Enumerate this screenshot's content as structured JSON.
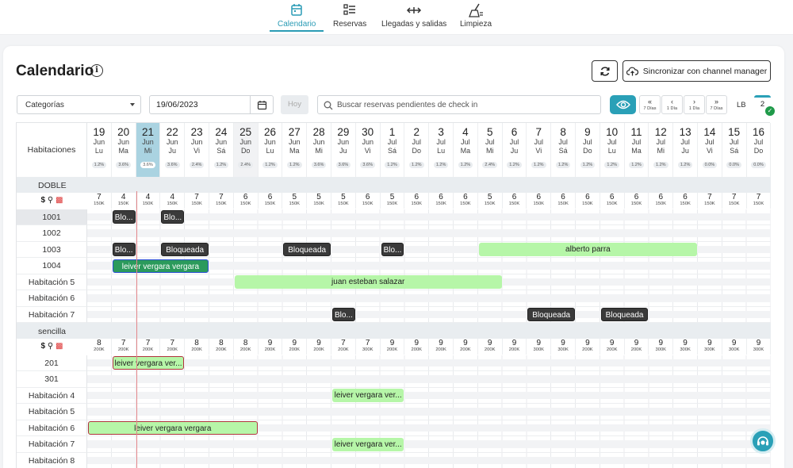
{
  "nav": [
    {
      "label": "Calendario",
      "icon": "calendar-icon",
      "active": true
    },
    {
      "label": "Reservas",
      "icon": "list-icon",
      "active": false
    },
    {
      "label": "Llegadas y salidas",
      "icon": "arrows-icon",
      "active": false
    },
    {
      "label": "Limpieza",
      "icon": "broom-icon",
      "active": false
    }
  ],
  "header": {
    "title": "Calendario",
    "info_icon": "i",
    "sync_label": "Sincronizar con channel manager"
  },
  "filters": {
    "category": "Categorías",
    "date": "19/06/2023",
    "today_label": "Hoy",
    "search_placeholder": "Buscar reservas pendientes de check in"
  },
  "nav_buttons": [
    {
      "chevron": "«",
      "label": "7 Días"
    },
    {
      "chevron": "‹",
      "label": "1 Día"
    },
    {
      "chevron": "›",
      "label": "1 Día"
    },
    {
      "chevron": "»",
      "label": "7 Días"
    }
  ],
  "lb_label": "LB",
  "badge_count": "2",
  "colors": {
    "accent": "#2aa0b7",
    "today": "#aad3e1",
    "booking": "#b6f6a8",
    "blocked": "#3a3a3a",
    "check": "#1f9a49"
  },
  "grid": {
    "rooms_header": "Habitaciones",
    "days": [
      {
        "n": "19",
        "m": "Jun",
        "w": "Lu",
        "pct": "1.2%"
      },
      {
        "n": "20",
        "m": "Jun",
        "w": "Ma",
        "pct": "3.6%"
      },
      {
        "n": "21",
        "m": "Jun",
        "w": "Mi",
        "pct": "3.6%",
        "today": true
      },
      {
        "n": "22",
        "m": "Jun",
        "w": "Ju",
        "pct": "3.6%"
      },
      {
        "n": "23",
        "m": "Jun",
        "w": "Vi",
        "pct": "2.4%"
      },
      {
        "n": "24",
        "m": "Jun",
        "w": "Sá",
        "pct": "1.2%"
      },
      {
        "n": "25",
        "m": "Jun",
        "w": "Do",
        "pct": "2.4%",
        "wknd": true
      },
      {
        "n": "26",
        "m": "Jun",
        "w": "Lu",
        "pct": "1.2%"
      },
      {
        "n": "27",
        "m": "Jun",
        "w": "Ma",
        "pct": "1.2%"
      },
      {
        "n": "28",
        "m": "Jun",
        "w": "Mi",
        "pct": "3.6%"
      },
      {
        "n": "29",
        "m": "Jun",
        "w": "Ju",
        "pct": "3.6%"
      },
      {
        "n": "30",
        "m": "Jun",
        "w": "Vi",
        "pct": "3.6%"
      },
      {
        "n": "1",
        "m": "Jul",
        "w": "Sá",
        "pct": "1.2%"
      },
      {
        "n": "2",
        "m": "Jul",
        "w": "Do",
        "pct": "1.2%"
      },
      {
        "n": "3",
        "m": "Jul",
        "w": "Lu",
        "pct": "1.2%"
      },
      {
        "n": "4",
        "m": "Jul",
        "w": "Ma",
        "pct": "1.2%"
      },
      {
        "n": "5",
        "m": "Jul",
        "w": "Mi",
        "pct": "2.4%"
      },
      {
        "n": "6",
        "m": "Jul",
        "w": "Ju",
        "pct": "1.2%"
      },
      {
        "n": "7",
        "m": "Jul",
        "w": "Vi",
        "pct": "1.2%"
      },
      {
        "n": "8",
        "m": "Jul",
        "w": "Sá",
        "pct": "1.2%"
      },
      {
        "n": "9",
        "m": "Jul",
        "w": "Do",
        "pct": "1.2%"
      },
      {
        "n": "10",
        "m": "Jul",
        "w": "Lu",
        "pct": "1.2%"
      },
      {
        "n": "11",
        "m": "Jul",
        "w": "Ma",
        "pct": "1.2%"
      },
      {
        "n": "12",
        "m": "Jul",
        "w": "Mi",
        "pct": "1.2%"
      },
      {
        "n": "13",
        "m": "Jul",
        "w": "Ju",
        "pct": "1.2%"
      },
      {
        "n": "14",
        "m": "Jul",
        "w": "Vi",
        "pct": "0.0%"
      },
      {
        "n": "15",
        "m": "Jul",
        "w": "Sá",
        "pct": "0.0%"
      },
      {
        "n": "16",
        "m": "Jul",
        "w": "Do",
        "pct": "0.0%"
      }
    ],
    "sections": [
      {
        "name": "DOBLE",
        "avail": [
          "7",
          "4",
          "4",
          "4",
          "7",
          "7",
          "6",
          "6",
          "5",
          "5",
          "5",
          "6",
          "5",
          "6",
          "6",
          "6",
          "5",
          "6",
          "6",
          "6",
          "6",
          "6",
          "6",
          "6",
          "6",
          "7",
          "7",
          "7"
        ],
        "price": "150K",
        "rooms": [
          {
            "name": "1001",
            "shaded": true,
            "blocks": [
              {
                "start": 1,
                "end": 2,
                "label": "Blo...",
                "kind": "dark"
              },
              {
                "start": 3,
                "end": 4,
                "label": "Blo...",
                "kind": "dark"
              }
            ]
          },
          {
            "name": "1002",
            "blocks": []
          },
          {
            "name": "1003",
            "blocks": [
              {
                "start": 1,
                "end": 2,
                "label": "Blo...",
                "kind": "dark"
              },
              {
                "start": 3,
                "end": 5,
                "label": "Bloqueada",
                "kind": "dark"
              },
              {
                "start": 8,
                "end": 10,
                "label": "Bloqueada",
                "kind": "dark"
              },
              {
                "start": 12,
                "end": 13,
                "label": "Blo...",
                "kind": "dark"
              },
              {
                "start": 16,
                "end": 25,
                "label": "alberto parra",
                "kind": "green"
              }
            ]
          },
          {
            "name": "1004",
            "blocks": [
              {
                "start": 1,
                "end": 5,
                "label": "leiver vergara vergara",
                "kind": "green-blue"
              }
            ]
          },
          {
            "name": "Habitación 5",
            "blocks": [
              {
                "start": 6,
                "end": 17,
                "label": "juan esteban salazar",
                "kind": "green"
              }
            ]
          },
          {
            "name": "Habitación 6",
            "blocks": []
          },
          {
            "name": "Habitación 7",
            "blocks": [
              {
                "start": 10,
                "end": 11,
                "label": "Blo...",
                "kind": "dark"
              },
              {
                "start": 18,
                "end": 20,
                "label": "Bloqueada",
                "kind": "dark"
              },
              {
                "start": 21,
                "end": 23,
                "label": "Bloqueada",
                "kind": "dark"
              }
            ]
          }
        ]
      },
      {
        "name": "sencilla",
        "avail": [
          "8",
          "7",
          "7",
          "7",
          "8",
          "8",
          "8",
          "9",
          "9",
          "9",
          "7",
          "7",
          "9",
          "9",
          "9",
          "9",
          "9",
          "9",
          "9",
          "9",
          "9",
          "9",
          "9",
          "9",
          "9",
          "9",
          "9",
          "9"
        ],
        "price_list": [
          "200K",
          "200K",
          "200K",
          "200K",
          "200K",
          "200K",
          "200K",
          "200K",
          "200K",
          "200K",
          "200K",
          "300K",
          "200K",
          "200K",
          "200K",
          "200K",
          "200K",
          "200K",
          "300K",
          "300K",
          "200K",
          "200K",
          "200K",
          "300K",
          "300K",
          "300K",
          "300K",
          "300K"
        ],
        "rooms": [
          {
            "name": "201",
            "blocks": [
              {
                "start": 1,
                "end": 4,
                "label": "leiver vergara ver...",
                "kind": "green-red"
              }
            ]
          },
          {
            "name": "301",
            "blocks": []
          },
          {
            "name": "Habitación 4",
            "blocks": [
              {
                "start": 10,
                "end": 13,
                "label": "leiver vergara ver...",
                "kind": "green"
              }
            ]
          },
          {
            "name": "Habitación 5",
            "blocks": []
          },
          {
            "name": "Habitación 6",
            "blocks": [
              {
                "start": 0,
                "end": 7,
                "label": "leiver vergara vergara",
                "kind": "green-red"
              }
            ]
          },
          {
            "name": "Habitación 7",
            "blocks": [
              {
                "start": 10,
                "end": 13,
                "label": "leiver vergara ver...",
                "kind": "green"
              }
            ]
          },
          {
            "name": "Habitación 8",
            "blocks": []
          }
        ]
      }
    ]
  }
}
